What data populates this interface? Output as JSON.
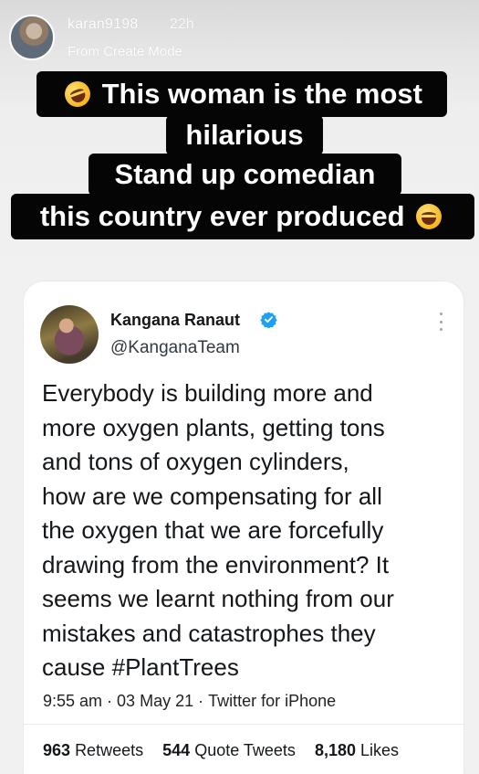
{
  "story": {
    "username": "karan9198",
    "time": "22h",
    "subtitle": "From Create Mode",
    "caption_lines": [
      "This woman is the most",
      "hilarious",
      "Stand up comedian",
      "this country ever produced"
    ],
    "icons": [
      "profile-avatar",
      "rolling-laughing-emoji",
      "tears-of-joy-emoji"
    ]
  },
  "tweet": {
    "name": "Kangana Ranaut",
    "handle": "@KanganaTeam",
    "verified": true,
    "text": "Everybody is building more and\nmore oxygen plants, getting tons\nand tons of oxygen cylinders,\nhow are we compensating for all\nthe oxygen that we are forcefully\ndrawing from the environment? It\nseems we learnt nothing from our\nmistakes and catastrophes they\ncause #PlantTrees",
    "time": "9:55 am",
    "date": "03 May 21",
    "source": "Twitter for iPhone",
    "stats": {
      "retweets": "963",
      "retweets_label": "Retweets",
      "quotes": "544",
      "quotes_label": "Quote Tweets",
      "likes": "8,180",
      "likes_label": "Likes"
    }
  },
  "colors": {
    "caption_bg": "#050505",
    "caption_text": "#ffffff",
    "verified_blue": "#1da1f2",
    "tweet_text": "#14171a"
  }
}
